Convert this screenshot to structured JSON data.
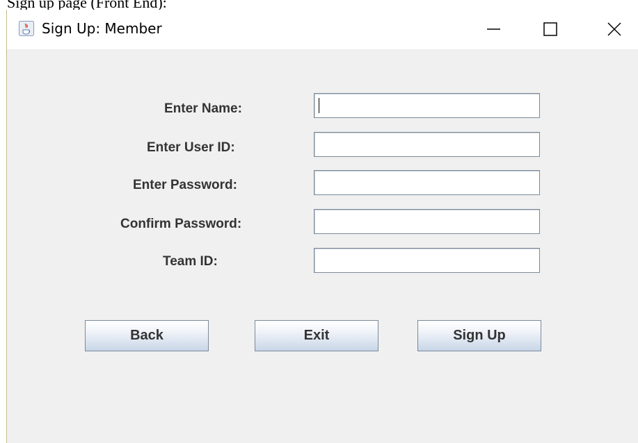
{
  "background_text": "Sign up page (Front End):",
  "window": {
    "title": "Sign Up: Member",
    "icons": {
      "app": "java-cup-icon",
      "minimize": "minimize-icon",
      "maximize": "maximize-icon",
      "close": "close-icon"
    }
  },
  "form": {
    "fields": [
      {
        "label": "Enter Name:",
        "value": "",
        "focused": true
      },
      {
        "label": "Enter User ID:",
        "value": ""
      },
      {
        "label": "Enter Password:",
        "value": ""
      },
      {
        "label": "Confirm Password:",
        "value": ""
      },
      {
        "label": "Team ID:",
        "value": ""
      }
    ]
  },
  "buttons": {
    "back": "Back",
    "exit": "Exit",
    "signup": "Sign Up"
  }
}
